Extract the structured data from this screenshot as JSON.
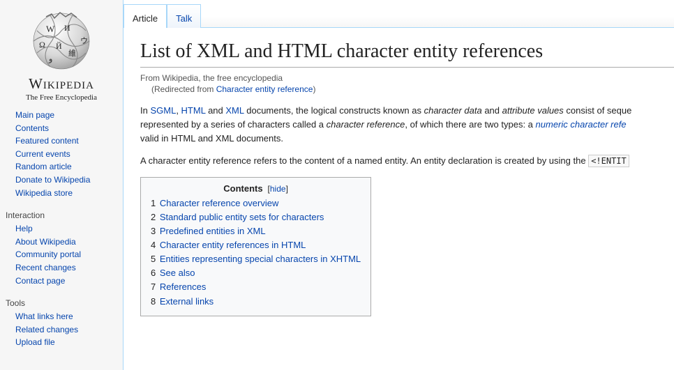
{
  "logo": {
    "wordmark": "Wikipedia",
    "slogan": "The Free Encyclopedia"
  },
  "sidebar": {
    "main": [
      "Main page",
      "Contents",
      "Featured content",
      "Current events",
      "Random article",
      "Donate to Wikipedia",
      "Wikipedia store"
    ],
    "interaction_heading": "Interaction",
    "interaction": [
      "Help",
      "About Wikipedia",
      "Community portal",
      "Recent changes",
      "Contact page"
    ],
    "tools_heading": "Tools",
    "tools": [
      "What links here",
      "Related changes",
      "Upload file"
    ]
  },
  "tabs": {
    "article": "Article",
    "talk": "Talk"
  },
  "article": {
    "title": "List of XML and HTML character entity references",
    "siteSub": "From Wikipedia, the free encyclopedia",
    "redirect_prefix": "(Redirected from ",
    "redirect_link": "Character entity reference",
    "redirect_suffix": ")",
    "p1_a": "In ",
    "p1_link1": "SGML",
    "p1_b": ", ",
    "p1_link2": "HTML",
    "p1_c": " and ",
    "p1_link3": "XML",
    "p1_d": " documents, the logical constructs known as ",
    "p1_i1": "character data",
    "p1_e": " and ",
    "p1_i2": "attribute values",
    "p1_f": " consist of seque",
    "p1_line2a": "represented by a series of characters called a ",
    "p1_i3": "character reference",
    "p1_line2b": ", of which there are two types: a ",
    "p1_link4": "numeric character refe",
    "p1_line3": "valid in HTML and XML documents.",
    "p2_a": "A character entity reference refers to the content of a named entity. An entity declaration is created by using the ",
    "p2_code": "<!ENTIT"
  },
  "toc": {
    "title": "Contents",
    "hide": "hide",
    "items": [
      {
        "n": "1",
        "t": "Character reference overview"
      },
      {
        "n": "2",
        "t": "Standard public entity sets for characters"
      },
      {
        "n": "3",
        "t": "Predefined entities in XML"
      },
      {
        "n": "4",
        "t": "Character entity references in HTML"
      },
      {
        "n": "5",
        "t": "Entities representing special characters in XHTML"
      },
      {
        "n": "6",
        "t": "See also"
      },
      {
        "n": "7",
        "t": "References"
      },
      {
        "n": "8",
        "t": "External links"
      }
    ]
  }
}
